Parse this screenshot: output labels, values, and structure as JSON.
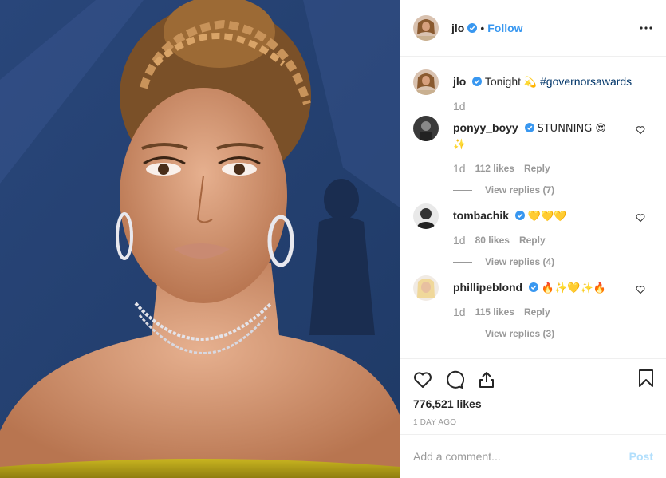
{
  "header": {
    "username": "jlo",
    "separator": "•",
    "follow_label": "Follow",
    "more_icon": "more-horizontal-icon"
  },
  "caption": {
    "username": "jlo",
    "text": "Tonight",
    "emoji": "💫",
    "hashtag": "#governorsawards",
    "time": "1d"
  },
  "comments": [
    {
      "username": "ponyy_boyy",
      "text": "STUNNING 😍",
      "text2": "✨",
      "time": "1d",
      "likes": "112 likes",
      "reply": "Reply",
      "view_replies": "View replies (7)"
    },
    {
      "username": "tombachik",
      "text": "💛💛💛",
      "text2": "",
      "time": "1d",
      "likes": "80 likes",
      "reply": "Reply",
      "view_replies": "View replies (4)"
    },
    {
      "username": "phillipeblond",
      "text": "🔥✨💛✨🔥",
      "text2": "",
      "time": "1d",
      "likes": "115 likes",
      "reply": "Reply",
      "view_replies": "View replies (3)"
    }
  ],
  "actions": {
    "like_icon": "heart-icon",
    "comment_icon": "comment-icon",
    "share_icon": "share-icon",
    "save_icon": "bookmark-icon",
    "likes_total": "776,521 likes",
    "date": "1 DAY AGO"
  },
  "add_comment": {
    "placeholder": "Add a comment...",
    "post_label": "Post"
  },
  "colors": {
    "accent": "#3897f0",
    "verified": "#3897f0",
    "post_disabled": "#b2dffc",
    "muted": "#999999",
    "photo_bg": "#2d4a78"
  }
}
